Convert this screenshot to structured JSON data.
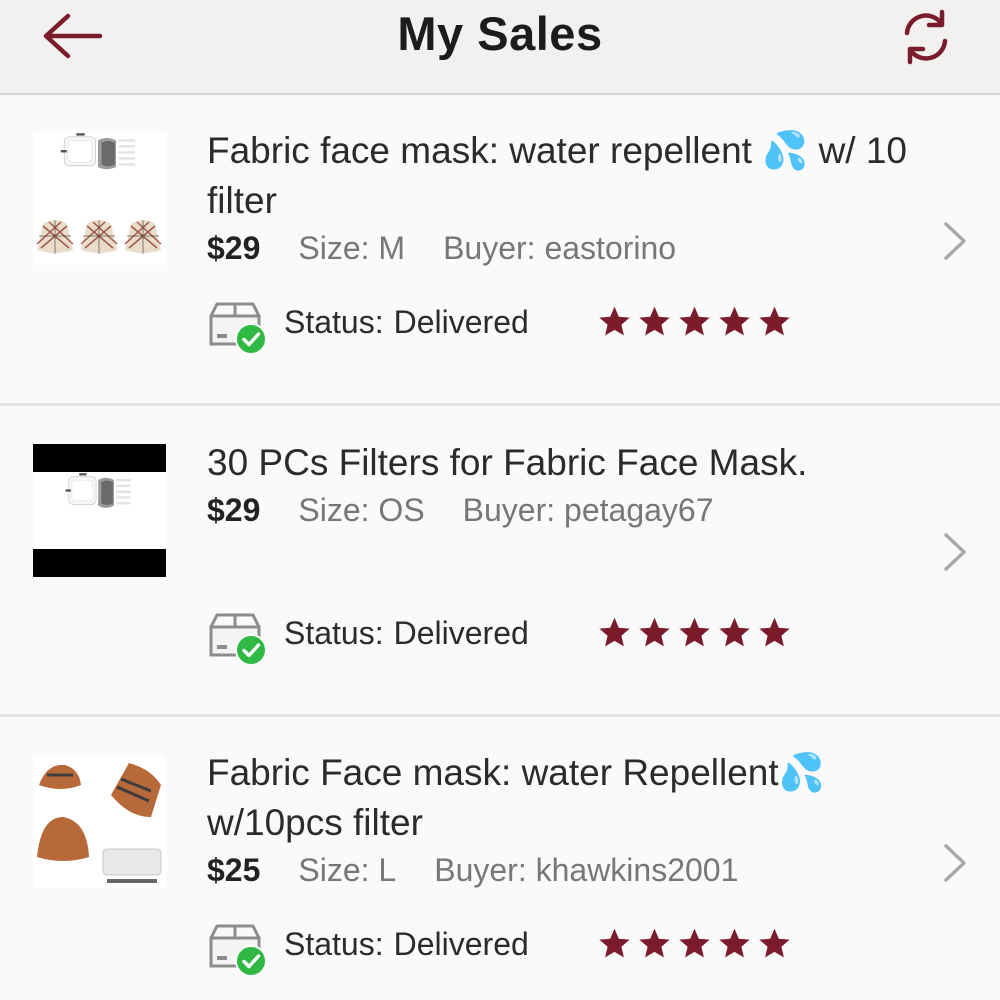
{
  "header": {
    "title": "My Sales",
    "back_icon": "arrow-left-icon",
    "refresh_icon": "refresh-icon"
  },
  "colors": {
    "accent": "#7b1c2c",
    "success": "#2fb844",
    "muted_text": "#777777",
    "header_bg": "#f3f1ef"
  },
  "sales": [
    {
      "title": "Fabric face mask: water repellent 💦 w/ 10 filter",
      "price": "$29",
      "size": "Size: M",
      "buyer": "Buyer: eastorino",
      "status_label": "Status:",
      "status_value": "Delivered",
      "rating": 5,
      "rating_max": 5
    },
    {
      "title": "30 PCs Filters for Fabric Face Mask.",
      "price": "$29",
      "size": "Size: OS",
      "buyer": "Buyer: petagay67",
      "status_label": "Status:",
      "status_value": "Delivered",
      "rating": 5,
      "rating_max": 5
    },
    {
      "title": "Fabric Face mask: water Repellent💦 w/10pcs filter",
      "price": "$25",
      "size": "Size: L",
      "buyer": "Buyer: khawkins2001",
      "status_label": "Status:",
      "status_value": "Delivered",
      "rating": 5,
      "rating_max": 5
    }
  ]
}
